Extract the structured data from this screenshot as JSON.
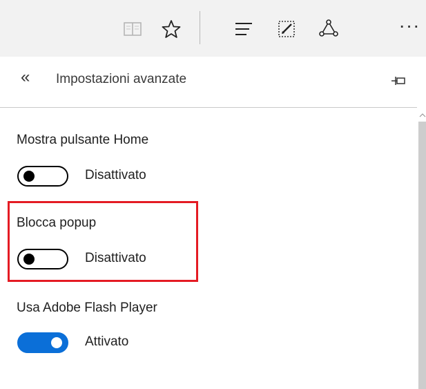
{
  "toolbar": {
    "icons": [
      "reading-view-icon",
      "favorite-star-icon",
      "hub-icon",
      "web-note-icon",
      "share-icon",
      "more-icon"
    ],
    "more_label": "···"
  },
  "panel": {
    "back_glyph": "«",
    "title": "Impostazioni avanzate"
  },
  "settings": [
    {
      "label": "Mostra pulsante Home",
      "state": "Disattivato",
      "on": false
    },
    {
      "label": "Blocca popup",
      "state": "Disattivato",
      "on": false,
      "highlighted": true
    },
    {
      "label": "Usa Adobe Flash Player",
      "state": "Attivato",
      "on": true
    }
  ],
  "colors": {
    "toolbar_bg": "#f2f2f2",
    "toggle_on": "#0b6fd8",
    "highlight": "#e41b23"
  }
}
